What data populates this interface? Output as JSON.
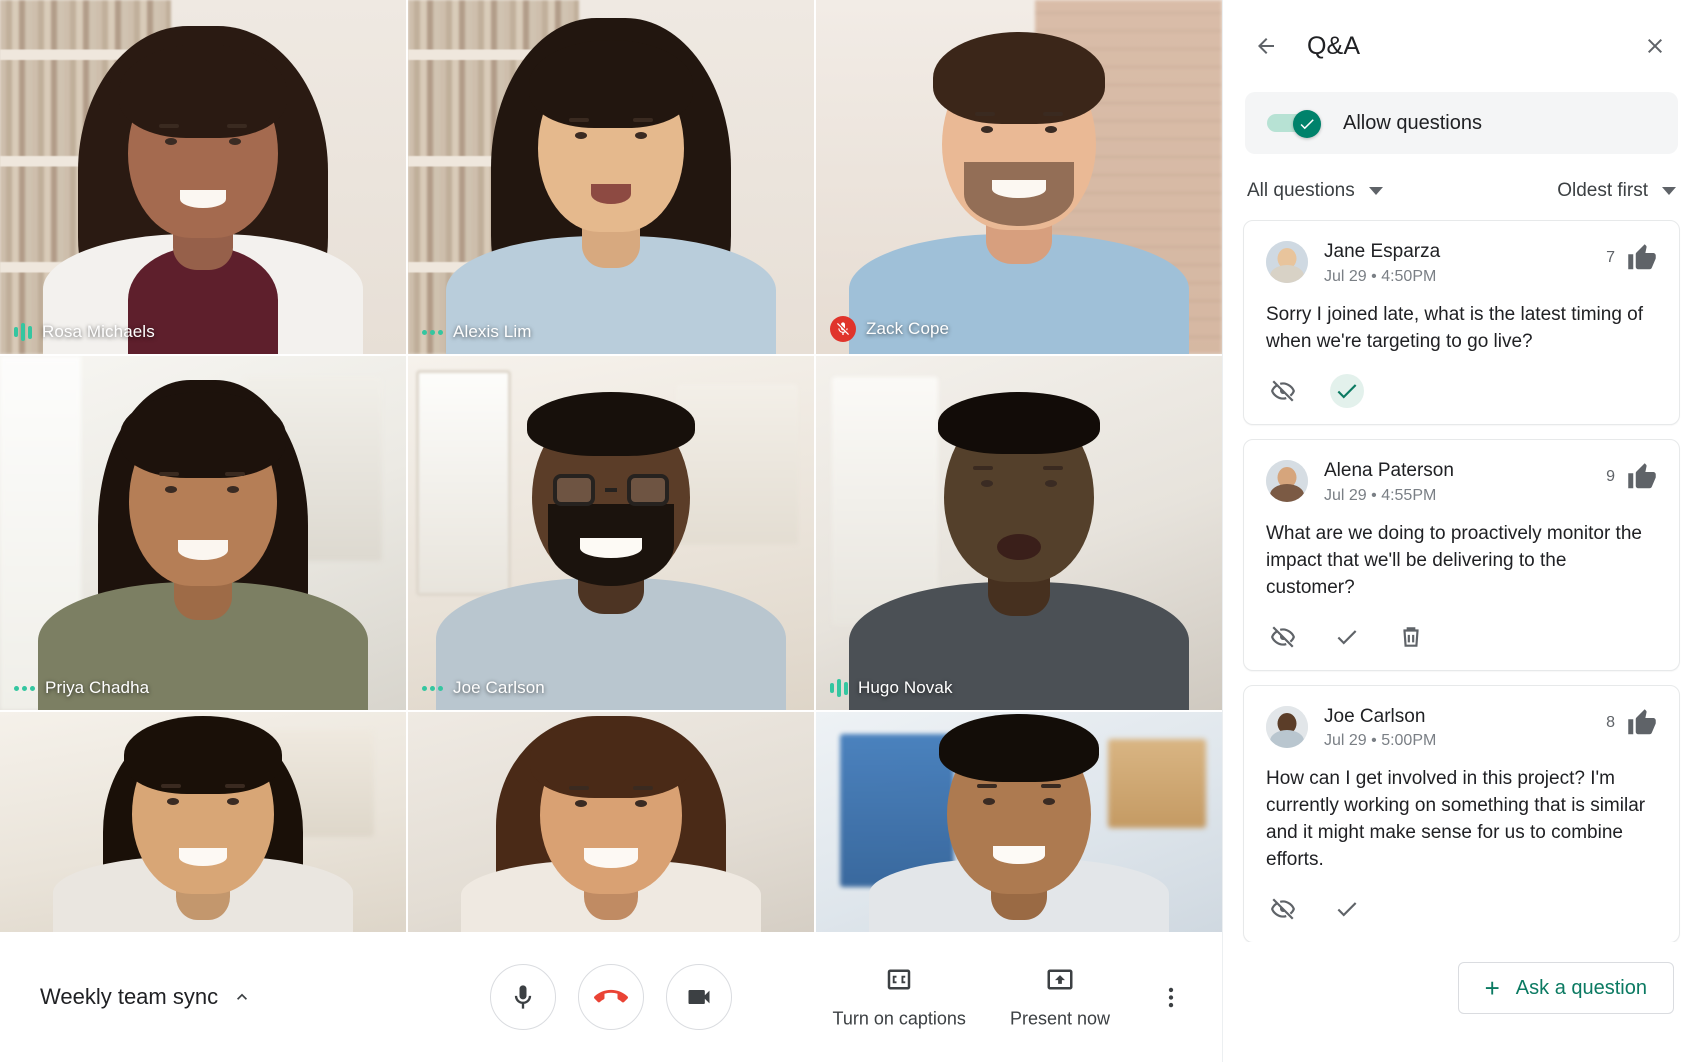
{
  "meeting": {
    "title": "Weekly team sync",
    "participants": [
      {
        "name": "Rosa Michaels",
        "mic": "speaking"
      },
      {
        "name": "Alexis Lim",
        "mic": "active"
      },
      {
        "name": "Zack Cope",
        "mic": "muted"
      },
      {
        "name": "Priya Chadha",
        "mic": "active"
      },
      {
        "name": "Joe Carlson",
        "mic": "active"
      },
      {
        "name": "Hugo Novak",
        "mic": "speaking"
      }
    ],
    "controls": {
      "mic_label": "Microphone",
      "hangup_label": "Leave call",
      "camera_label": "Camera",
      "captions_label": "Turn on captions",
      "present_label": "Present now",
      "more_label": "More options"
    }
  },
  "qa": {
    "title": "Q&A",
    "back_label": "Back",
    "close_label": "Close",
    "allow_questions_label": "Allow questions",
    "allow_questions_on": true,
    "filter_label": "All questions",
    "sort_label": "Oldest first",
    "ask_button_label": "Ask a question",
    "ask_button_plus": "+",
    "accent_color": "#0b7a62",
    "questions": [
      {
        "author": "Jane Esparza",
        "timestamp": "Jul 29 • 4:50PM",
        "likes": "7",
        "text": "Sorry I joined late, what is the latest timing of when we're targeting to go live?",
        "actions": [
          "hide",
          "mark-answered"
        ],
        "answered": true
      },
      {
        "author": "Alena Paterson",
        "timestamp": "Jul 29 • 4:55PM",
        "likes": "9",
        "text": "What are we doing to proactively monitor the impact that we'll be delivering to the customer?",
        "actions": [
          "hide",
          "mark-answered",
          "delete"
        ],
        "answered": false
      },
      {
        "author": "Joe Carlson",
        "timestamp": "Jul 29 • 5:00PM",
        "likes": "8",
        "text": "How can I get involved in this project? I'm currently working on something that is similar and it might make sense for us to combine efforts.",
        "actions": [
          "hide",
          "mark-answered"
        ],
        "answered": false
      }
    ]
  }
}
